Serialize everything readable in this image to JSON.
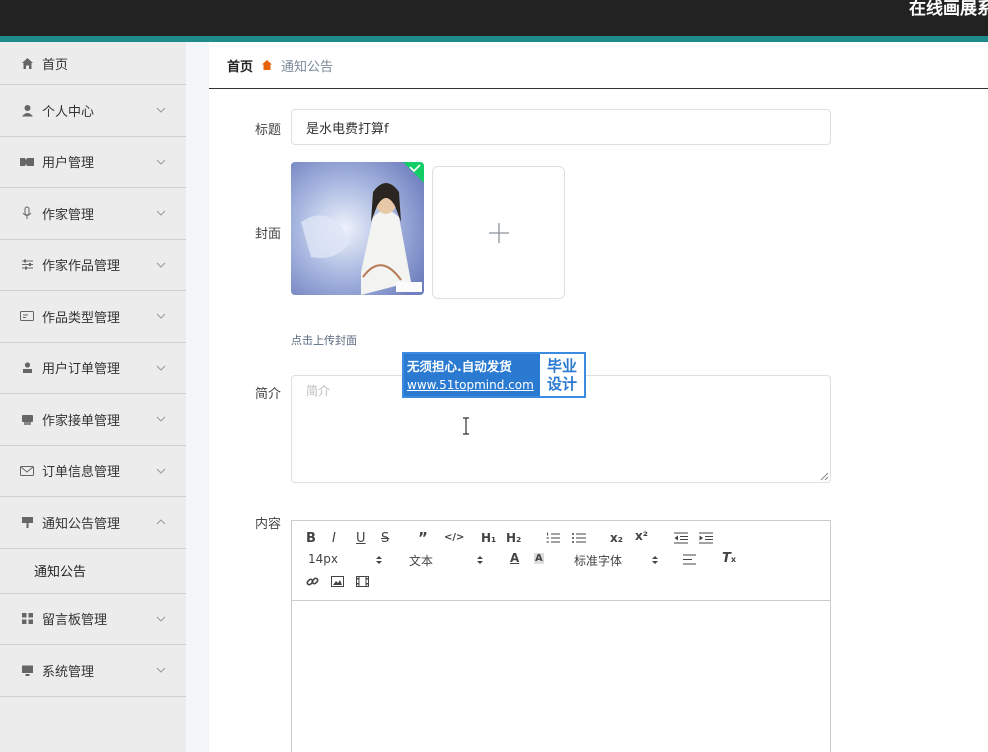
{
  "app": {
    "title": "在线画展系"
  },
  "sidebar": {
    "items": [
      {
        "label": "首页",
        "icon": "home-icon"
      },
      {
        "label": "个人中心",
        "icon": "user-icon"
      },
      {
        "label": "用户管理",
        "icon": "ticket-icon"
      },
      {
        "label": "作家管理",
        "icon": "microphone-icon"
      },
      {
        "label": "作家作品管理",
        "icon": "sliders-icon"
      },
      {
        "label": "作品类型管理",
        "icon": "card-icon"
      },
      {
        "label": "用户订单管理",
        "icon": "person-icon"
      },
      {
        "label": "作家接单管理",
        "icon": "printer-icon"
      },
      {
        "label": "订单信息管理",
        "icon": "mail-icon"
      },
      {
        "label": "通知公告管理",
        "icon": "flag-icon"
      },
      {
        "label": "留言板管理",
        "icon": "grid-icon"
      },
      {
        "label": "系统管理",
        "icon": "monitor-icon"
      }
    ],
    "submenu_label": "通知公告"
  },
  "breadcrumb": {
    "home": "首页",
    "current": "通知公告"
  },
  "form": {
    "title_label": "标题",
    "title_value": "是水电费打算f",
    "cover_label": "封面",
    "upload_tip": "点击上传封面",
    "summary_label": "简介",
    "summary_placeholder": "简介",
    "content_label": "内容"
  },
  "editor": {
    "font_size": "14px",
    "text_style": "文本",
    "font_family": "标准字体"
  },
  "watermark": {
    "line1": "无须担心.自动发货",
    "url": "www.51topmind.com",
    "right1": "毕业",
    "right2": "设计"
  },
  "colors": {
    "accent": "#1f8a8a",
    "topbar": "#222222",
    "badge": "#13ce66"
  }
}
